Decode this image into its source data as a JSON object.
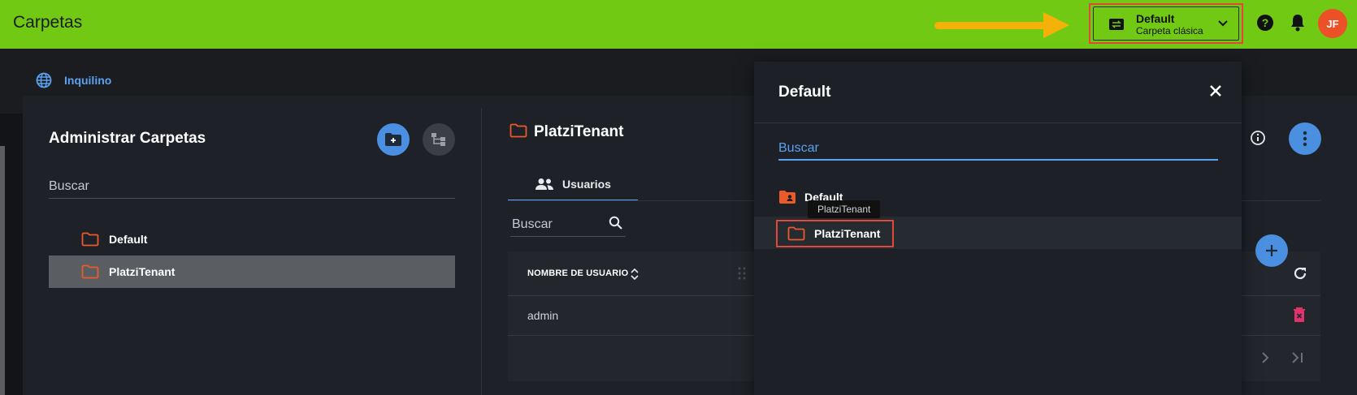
{
  "app": {
    "title": "Carpetas"
  },
  "topbar": {
    "folder_switcher": {
      "title": "Default",
      "subtitle": "Carpeta clásica"
    },
    "avatar_initials": "JF"
  },
  "breadcrumb": {
    "label": "Inquilino"
  },
  "left_panel": {
    "title": "Administrar Carpetas",
    "search_placeholder": "Buscar",
    "tree": [
      {
        "label": "Default"
      },
      {
        "label": "PlatziTenant",
        "selected": true
      }
    ]
  },
  "right_panel": {
    "folder_title": "PlatziTenant",
    "tabs": [
      {
        "label": "Usuarios",
        "active": true
      }
    ],
    "search_placeholder": "Buscar",
    "table": {
      "columns": [
        "NOMBRE DE USUARIO"
      ],
      "rows": [
        {
          "username": "admin"
        }
      ]
    }
  },
  "dropdown": {
    "title": "Default",
    "search_placeholder": "Buscar",
    "items": [
      {
        "label": "Default"
      },
      {
        "label": "PlatziTenant",
        "selected": true
      }
    ],
    "tooltip": "PlatziTenant"
  },
  "colors": {
    "topbar": "#72c914",
    "accent_blue": "#4a8fe0",
    "folder_orange": "#ec5a2a",
    "highlight_red": "#e2483a",
    "arrow": "#f3b109",
    "avatar": "#ec5027",
    "delete_pink": "#e0336b"
  }
}
